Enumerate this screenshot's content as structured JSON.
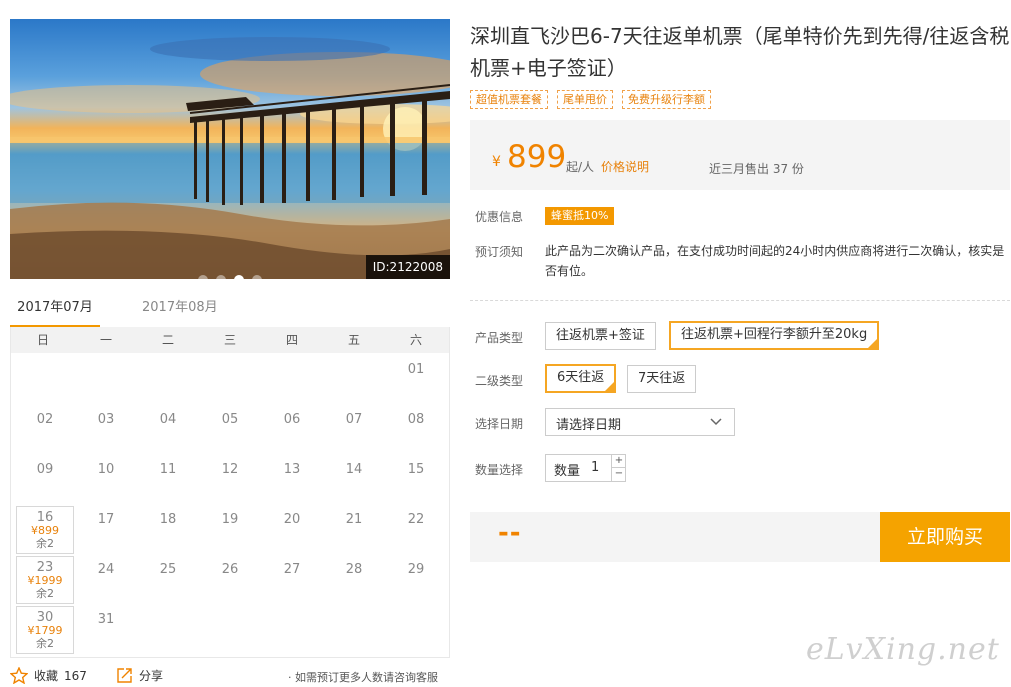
{
  "hero": {
    "image_id": "ID:2122008",
    "slide_count": 4,
    "active_slide": 3
  },
  "calendar": {
    "tabs": [
      "2017年07月",
      "2017年08月"
    ],
    "active_tab": 0,
    "weekdays": [
      "日",
      "一",
      "二",
      "三",
      "四",
      "五",
      "六"
    ],
    "first_weekday_index": 6,
    "days_in_month": 31,
    "priced_days": [
      {
        "day": "16",
        "price": "¥899",
        "remain": "余2"
      },
      {
        "day": "23",
        "price": "¥1999",
        "remain": "余2"
      },
      {
        "day": "30",
        "price": "¥1799",
        "remain": "余2"
      }
    ]
  },
  "bottom": {
    "favorite_label": "收藏",
    "favorite_count": "167",
    "share_label": "分享",
    "consult_text": "· 如需预订更多人数请咨询客服"
  },
  "product": {
    "title": "深圳直飞沙巴6-7天往返单机票（尾单特价先到先得/往返含税机票+电子签证）",
    "tags": [
      "超值机票套餐",
      "尾单甩价",
      "免费升级行李额"
    ]
  },
  "price": {
    "currency": "¥",
    "amount": "899",
    "unit": "起/人",
    "explain_link": "价格说明",
    "sold_text": "近三月售出 37 份"
  },
  "info": {
    "promo_label": "优惠信息",
    "promo_badge": "蜂蜜抵10%",
    "notice_label": "预订须知",
    "notice_text": "此产品为二次确认产品，在支付成功时间起的24小时内供应商将进行二次确认，核实是否有位。"
  },
  "options": {
    "product_type_label": "产品类型",
    "product_types": [
      "往返机票+签证",
      "往返机票+回程行李额升至20kg"
    ],
    "product_type_selected": 1,
    "sub_type_label": "二级类型",
    "sub_types": [
      "6天往返",
      "7天往返"
    ],
    "sub_type_selected": 0,
    "date_label": "选择日期",
    "date_placeholder": "请选择日期",
    "qty_section_label": "数量选择",
    "qty_label": "数量",
    "qty_value": "1",
    "plus": "+",
    "minus": "−"
  },
  "purchase": {
    "total": "--",
    "buy_label": "立即购买"
  },
  "watermark": "eLvXing.net",
  "colors": {
    "accent": "#f08300",
    "button": "#f5a300",
    "selected_border": "#f5a623"
  }
}
